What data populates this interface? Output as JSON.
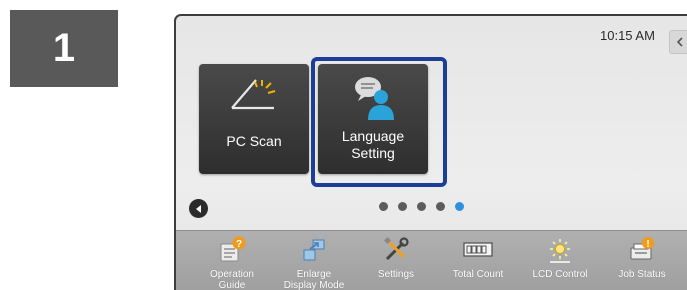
{
  "step": {
    "number": "1"
  },
  "status": {
    "time": "10:15 AM"
  },
  "tiles": [
    {
      "label": "PC Scan",
      "icon": "scanner-icon"
    },
    {
      "label_line1": "Language",
      "label_line2": "Setting",
      "icon": "language-setting-icon"
    }
  ],
  "pager": {
    "total": 5,
    "active_index": 4
  },
  "bottom_bar": [
    {
      "line1": "Operation",
      "line2": "Guide",
      "icon": "operation-guide-icon"
    },
    {
      "line1": "Enlarge",
      "line2": "Display Mode",
      "icon": "enlarge-display-icon"
    },
    {
      "line1": "Settings",
      "line2": "",
      "icon": "settings-tools-icon"
    },
    {
      "line1": "Total Count",
      "line2": "",
      "icon": "total-count-icon"
    },
    {
      "line1": "LCD Control",
      "line2": "",
      "icon": "lcd-brightness-icon"
    },
    {
      "line1": "Job Status",
      "line2": "",
      "icon": "job-status-icon"
    }
  ],
  "colors": {
    "step_badge": "#595959",
    "tile_bg": "#3a3a3a",
    "selection_frame": "#1b3f96",
    "active_dot": "#2c8fe0",
    "bottom_bar": "#a8a8a8"
  }
}
